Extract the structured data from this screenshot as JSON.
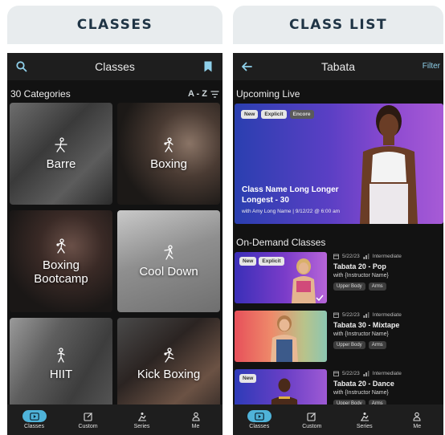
{
  "left": {
    "header": "CLASSES",
    "topbar_title": "Classes",
    "count_label": "30 Categories",
    "sort_label": "A - Z",
    "tiles": [
      {
        "label": "Barre",
        "icon": "barre-icon"
      },
      {
        "label": "Boxing",
        "icon": "boxing-icon"
      },
      {
        "label": "Boxing\nBootcamp",
        "icon": "boxing-icon"
      },
      {
        "label": "Cool Down",
        "icon": "stretch-icon"
      },
      {
        "label": "HIIT",
        "icon": "hiit-icon"
      },
      {
        "label": "Kick Boxing",
        "icon": "kickboxing-icon"
      }
    ]
  },
  "right": {
    "header": "CLASS LIST",
    "topbar_title": "Tabata",
    "filter_label": "Filter",
    "upcoming_title": "Upcoming Live",
    "hero": {
      "badges": [
        "New",
        "Explicit",
        "Encore"
      ],
      "name": "Class Name Long Longer Longest - 30",
      "subtitle": "with Amy Long Name | 9/12/22 @ 6:00 am"
    },
    "ondemand_title": "On-Demand Classes",
    "classes": [
      {
        "date": "5/22/23",
        "level": "Intermediate",
        "title": "Tabata 20 - Pop",
        "instructor": "with {Instructor Name}",
        "chips": [
          "Upper Body",
          "Arms"
        ],
        "badges": [
          "New",
          "Explicit"
        ]
      },
      {
        "date": "5/22/23",
        "level": "Intermediate",
        "title": "Tabata 30 - Mixtape",
        "instructor": "with {Instructor Name}",
        "chips": [
          "Upper Body",
          "Arms"
        ],
        "badges": []
      },
      {
        "date": "5/22/23",
        "level": "Intermediate",
        "title": "Tabata 20 - Dance",
        "instructor": "with {Instructor Name}",
        "chips": [
          "Upper Body",
          "Arms"
        ],
        "badges": [
          "New"
        ]
      }
    ]
  },
  "nav": {
    "items": [
      "Classes",
      "Custom",
      "Series",
      "Me"
    ],
    "active_index": 0
  },
  "colors": {
    "accent": "#4fb3d9",
    "header_text": "#1f3445",
    "header_bg": "#e8ecee",
    "app_bg": "#121212"
  }
}
